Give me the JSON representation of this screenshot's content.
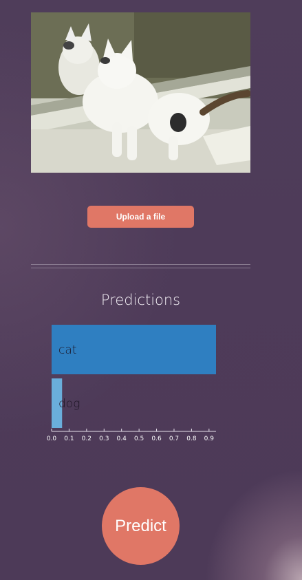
{
  "upload": {
    "label": "Upload a file"
  },
  "predictions": {
    "title": "Predictions"
  },
  "predict": {
    "label": "Predict"
  },
  "colors": {
    "accent": "#e07766",
    "bar_primary": "#2f7fc1",
    "bar_secondary": "#6aaedb"
  },
  "chart_data": {
    "type": "bar",
    "orientation": "horizontal",
    "categories": [
      "cat",
      "dog"
    ],
    "values": [
      0.94,
      0.06
    ],
    "xlim": [
      0,
      0.94
    ],
    "xticks": [
      "0.0",
      "0.1",
      "0.2",
      "0.3",
      "0.4",
      "0.5",
      "0.6",
      "0.7",
      "0.8",
      "0.9"
    ],
    "title": "",
    "xlabel": "",
    "ylabel": ""
  }
}
